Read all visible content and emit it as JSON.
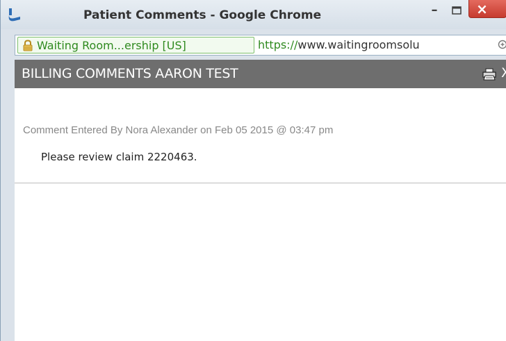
{
  "window": {
    "title": "Patient Comments - Google Chrome",
    "min_symbol": "–",
    "close_symbol": "×"
  },
  "address_bar": {
    "cert_label": "Waiting Room...ership [US]",
    "url_scheme": "https://",
    "url_rest": "www.waitingroomsolu"
  },
  "page": {
    "header_title": "BILLING COMMENTS AARON TEST",
    "close_label": "X",
    "comments": [
      {
        "meta": "Comment Entered By Nora Alexander on Feb 05 2015 @ 03:47 pm",
        "text": "Please review claim 2220463."
      }
    ]
  },
  "colors": {
    "header_bg": "#6e6e6e",
    "secure_green": "#2f8a1f",
    "close_red": "#c63b2f"
  },
  "icons": [
    "app-icon",
    "lock-icon",
    "zoom-icon",
    "print-icon",
    "close-icon"
  ]
}
